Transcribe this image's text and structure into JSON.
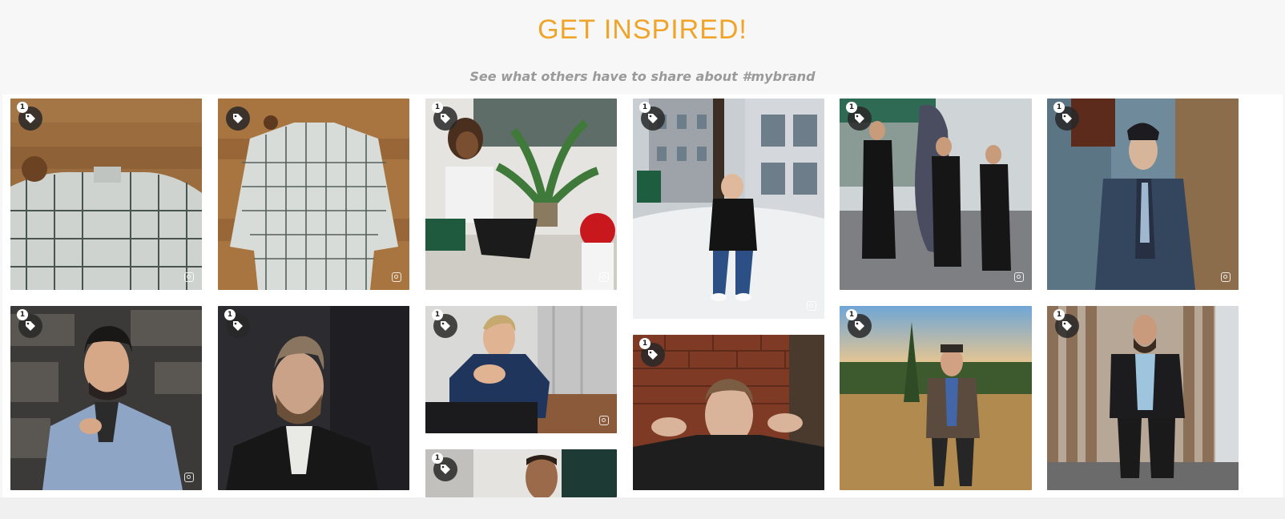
{
  "header": {
    "title": "GET INSPIRED!",
    "subtitle": "See what others have to share about #mybrand"
  },
  "colors": {
    "accent": "#f0a52a",
    "subtitle": "#9a9a9a",
    "badge": "#282828"
  },
  "gallery": {
    "items": [
      {
        "id": "post-1",
        "description": "green plaid shirt on wooden table",
        "tag_count": "1",
        "icon": "tag-icon"
      },
      {
        "id": "post-2",
        "description": "light plaid shirt laid flat on wood",
        "tag_count": "",
        "icon": "tag-icon"
      },
      {
        "id": "post-3",
        "description": "woman on sofa with palm plant",
        "tag_count": "1",
        "icon": "tag-icon"
      },
      {
        "id": "post-4",
        "description": "man in black coat in snow",
        "tag_count": "1",
        "icon": "tag-icon"
      },
      {
        "id": "post-5",
        "description": "three men with cello case",
        "tag_count": "1",
        "icon": "tag-icon"
      },
      {
        "id": "post-6",
        "description": "man in grey overcoat against wall",
        "tag_count": "1",
        "icon": "tag-icon"
      },
      {
        "id": "post-7",
        "description": "man in light blue blazer by stones",
        "tag_count": "1",
        "icon": "tag-icon"
      },
      {
        "id": "post-8",
        "description": "smiling man in dark jacket",
        "tag_count": "1",
        "icon": "tag-icon"
      },
      {
        "id": "post-9",
        "description": "man in navy shirt seated",
        "tag_count": "1",
        "icon": "tag-icon"
      },
      {
        "id": "post-10",
        "description": "man in leather jacket by brick wall",
        "tag_count": "1",
        "icon": "tag-icon"
      },
      {
        "id": "post-11",
        "description": "man in tweed jacket in landscape",
        "tag_count": "1",
        "icon": "tag-icon"
      },
      {
        "id": "post-12",
        "description": "man in black suit by glass building",
        "tag_count": "1",
        "icon": "tag-icon"
      },
      {
        "id": "post-13",
        "description": "man partially visible",
        "tag_count": "1",
        "icon": "tag-icon"
      }
    ]
  }
}
